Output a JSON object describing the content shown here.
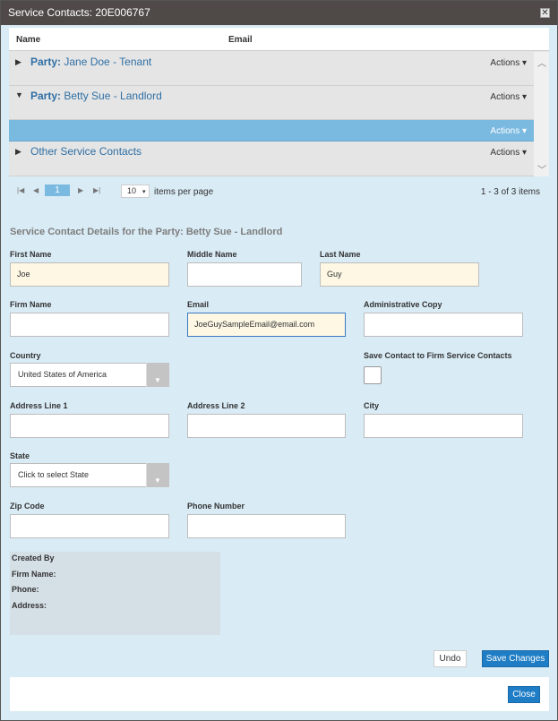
{
  "dialog": {
    "title": "Service Contacts: 20E006767",
    "close_glyph": "✕"
  },
  "grid": {
    "columns": [
      "Name",
      "Email"
    ],
    "rows": [
      {
        "prefix": "Party:",
        "label": "Jane Doe - Tenant",
        "expander": "▶",
        "actions": "Actions ▾"
      },
      {
        "prefix": "Party:",
        "label": "Betty Sue - Landlord",
        "expander": "▼",
        "actions": "Actions ▾"
      },
      {
        "prefix": "",
        "label": "",
        "expander": "",
        "actions": "Actions ▾"
      },
      {
        "prefix": "",
        "label": "Other Service Contacts",
        "expander": "▶",
        "actions": "Actions ▾"
      }
    ],
    "scroll_up": "︿",
    "scroll_down": "﹀"
  },
  "pager": {
    "first": "|◀",
    "prev": "◀",
    "current_page": "1",
    "next": "▶",
    "last": "▶|",
    "page_size": "10",
    "page_size_arrow": "▾",
    "items_per_page": "items per page",
    "info": "1 - 3 of 3 items"
  },
  "form": {
    "section_title": "Service Contact Details for the Party: Betty Sue - Landlord",
    "first_name_label": "First Name",
    "first_name_value": "Joe",
    "middle_name_label": "Middle Name",
    "middle_name_value": "",
    "last_name_label": "Last Name",
    "last_name_value": "Guy",
    "firm_name_label": "Firm Name",
    "firm_name_value": "",
    "email_label": "Email",
    "email_value": "JoeGuySampleEmail@email.com",
    "admin_copy_label": "Administrative Copy",
    "admin_copy_value": "",
    "country_label": "Country",
    "country_value": "United States of America",
    "save_contact_label": "Save Contact to Firm Service Contacts",
    "address1_label": "Address Line 1",
    "address2_label": "Address Line 2",
    "city_label": "City",
    "state_label": "State",
    "state_value": "Click to select State",
    "zip_label": "Zip Code",
    "phone_label": "Phone Number",
    "select_arrow": "▼"
  },
  "info": {
    "created_by": "Created By",
    "firm_name": "Firm Name:",
    "phone": "Phone:",
    "address": "Address:"
  },
  "buttons": {
    "undo": "Undo",
    "save": "Save Changes",
    "close": "Close"
  }
}
